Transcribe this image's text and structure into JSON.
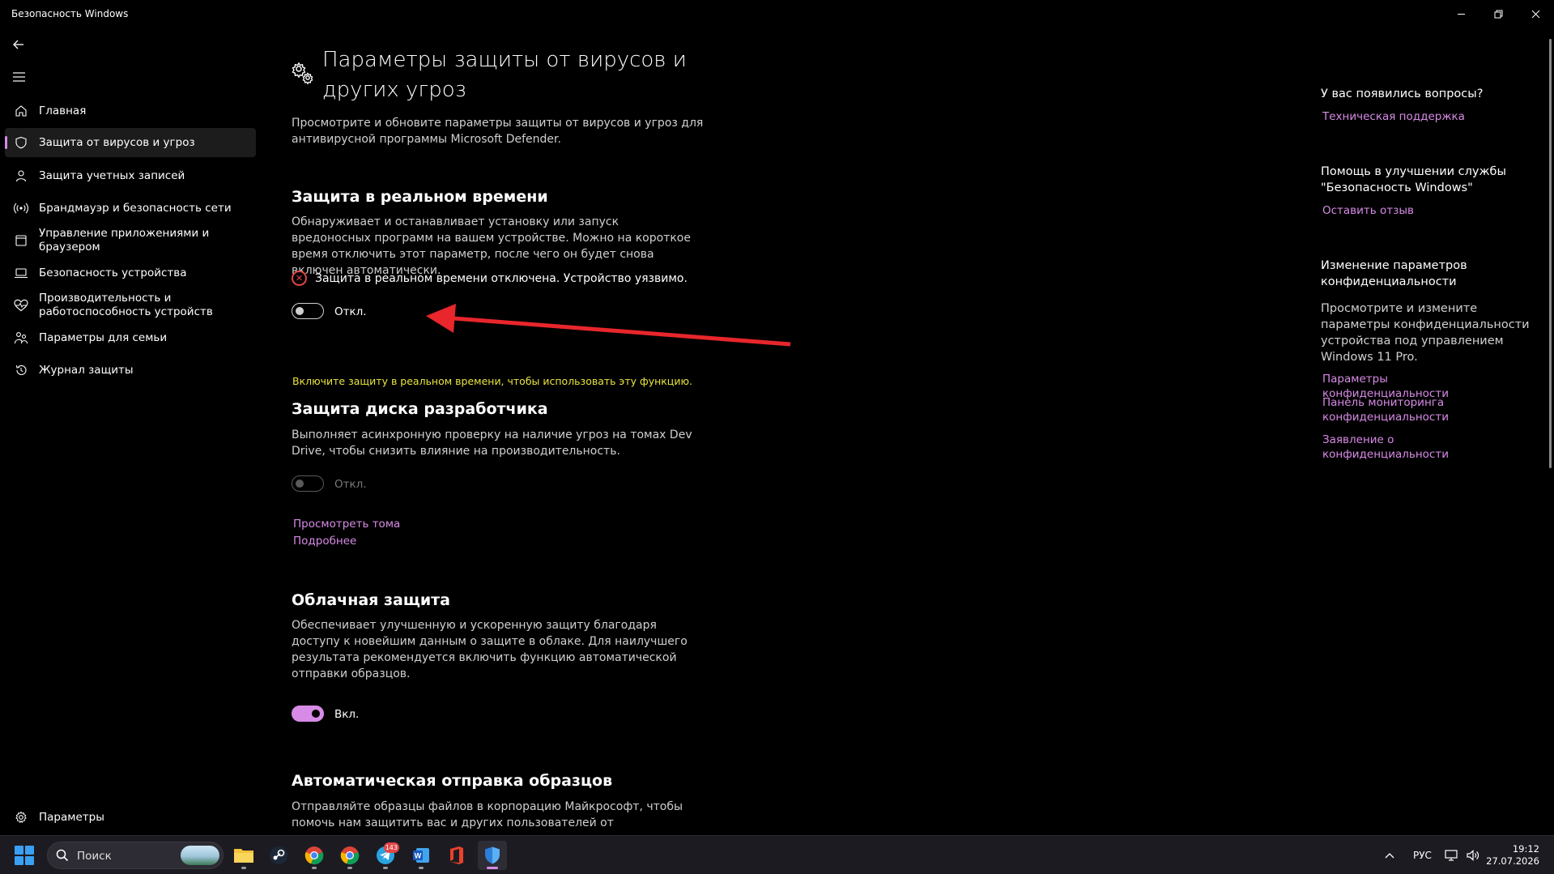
{
  "window": {
    "title": "Безопасность Windows"
  },
  "sidebar": {
    "items": [
      {
        "label": "Главная",
        "icon": "home-icon"
      },
      {
        "label": "Защита от вирусов и угроз",
        "icon": "shield-icon",
        "active": true
      },
      {
        "label": "Защита учетных записей",
        "icon": "person-icon"
      },
      {
        "label": "Брандмауэр и безопасность сети",
        "icon": "wifi-signal-icon"
      },
      {
        "label": "Управление приложениями и браузером",
        "icon": "app-window-icon"
      },
      {
        "label": "Безопасность устройства",
        "icon": "laptop-icon"
      },
      {
        "label": "Производительность и работоспособность устройств",
        "icon": "heart-pulse-icon"
      },
      {
        "label": "Параметры для семьи",
        "icon": "family-icon"
      },
      {
        "label": "Журнал защиты",
        "icon": "history-icon"
      }
    ],
    "settings_label": "Параметры"
  },
  "main": {
    "title": "Параметры защиты от вирусов и других угроз",
    "subtitle": "Просмотрите и обновите параметры защиты от вирусов и угроз для антивирусной программы Microsoft Defender.",
    "realtime": {
      "heading": "Защита в реальном времени",
      "description": "Обнаруживает и останавливает установку или запуск вредоносных программ на вашем устройстве. Можно на короткое время отключить этот параметр, после чего он будет снова включен автоматически.",
      "status": "Защита в реальном времени отключена. Устройство уязвимо.",
      "toggle_label": "Откл.",
      "enabled": false
    },
    "devdrive": {
      "warning": "Включите защиту в реальном времени, чтобы использовать эту функцию.",
      "heading": "Защита диска разработчика",
      "description": "Выполняет асинхронную проверку на наличие угроз на томах Dev Drive, чтобы снизить влияние на производительность.",
      "toggle_label": "Откл.",
      "enabled": false,
      "link_volumes": "Просмотреть тома",
      "link_more": "Подробнее"
    },
    "cloud": {
      "heading": "Облачная защита",
      "description": "Обеспечивает улучшенную и ускоренную защиту благодаря доступу к новейшим данным о защите в облаке. Для наилучшего результата рекомендуется включить функцию автоматической отправки образцов.",
      "toggle_label": "Вкл.",
      "enabled": true
    },
    "samples": {
      "heading": "Автоматическая отправка образцов",
      "description": "Отправляйте образцы файлов в корпорацию Майкрософт, чтобы помочь нам защитить вас и других пользователей от потенциальных"
    }
  },
  "right": {
    "questions_heading": "У вас появились вопросы?",
    "support_link": "Техническая поддержка",
    "improve_heading": "Помощь в улучшении службы \"Безопасность Windows\"",
    "feedback_link": "Оставить отзыв",
    "privacy_heading": "Изменение параметров конфиденциальности",
    "privacy_text": "Просмотрите и измените параметры конфиденциальности устройства под управлением Windows 11 Pro.",
    "privacy_links": [
      "Параметры конфиденциальности",
      "Панель мониторинга конфиденциальности",
      "Заявление о конфиденциальности"
    ]
  },
  "taskbar": {
    "search_placeholder": "Поиск",
    "telegram_badge": "143",
    "language": "РУС",
    "time": "19:12",
    "date": "27.07.2026"
  },
  "colors": {
    "accent": "#d78be6",
    "warning": "#e9e43d",
    "error": "#e04646"
  }
}
